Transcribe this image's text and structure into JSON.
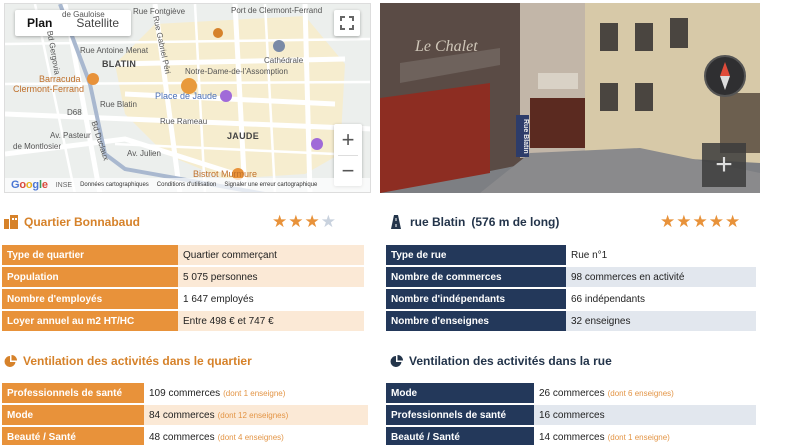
{
  "map": {
    "tab_plan": "Plan",
    "tab_satellite": "Satellite",
    "labels": {
      "port": "Port de Clermont-Ferrand",
      "fontgieve": "Rue Fontgiève",
      "blatin": "BLATIN",
      "jaude": "JAUDE",
      "cathedrale": "Cathédrale",
      "notredame": "Notre-Dame-de-l'Assomption",
      "place_jaude": "Place de Jaude",
      "barracuda": "Barracuda",
      "barracuda2": "Clermont-Ferrand",
      "bistrot": "Bistrot Murmure",
      "rue_blatin": "Rue Blatin",
      "rue_rameau": "Rue Rameau",
      "av_julien": "Av. Julien",
      "av_pasteur": "Av. Pasteur",
      "bd_duclaux": "Bd Duclaux",
      "rue_montlosier": "de Montlosier",
      "rue_menat": "Rue Antoine Menat",
      "rue_gabriel": "Rue Gabriel Péri",
      "bd_gergovia": "Bd Gergovia",
      "insee": "INSE",
      "d68": "D68",
      "gauloise": "de Gauloise"
    },
    "footer": {
      "data": "Données cartographiques",
      "terms": "Conditions d'utilisation",
      "report": "Signaler une erreur cartographique"
    },
    "zoom_in": "+",
    "zoom_out": "−"
  },
  "streetview": {
    "plus": "+",
    "sign": "Rue Blatin",
    "shop": "Le Chalet"
  },
  "quartier": {
    "title": "Quartier Bonnabaud",
    "rating": 3,
    "rating_max": 4,
    "rows": [
      {
        "label": "Type de quartier",
        "value": "Quartier commerçant"
      },
      {
        "label": "Population",
        "value": "5 075 personnes"
      },
      {
        "label": "Nombre d'employés",
        "value": "1 647 employés"
      },
      {
        "label": "Loyer annuel au m2 HT/HC",
        "value": "Entre 498 € et 747 €"
      }
    ]
  },
  "rue": {
    "title": "rue Blatin",
    "length": "(576 m de long)",
    "rating": 5,
    "rating_max": 5,
    "rows": [
      {
        "label": "Type de rue",
        "value": "Rue n°1"
      },
      {
        "label": "Nombre de commerces",
        "value": "98 commerces en activité"
      },
      {
        "label": "Nombre d'indépendants",
        "value": "66 indépendants"
      },
      {
        "label": "Nombre d'enseignes",
        "value": "32 enseignes"
      }
    ]
  },
  "vent_quartier": {
    "title": "Ventilation des activités dans le quartier",
    "rows": [
      {
        "label": "Professionnels de santé",
        "value": "109 commerces",
        "extra": "(dont 1 enseigne)"
      },
      {
        "label": "Mode",
        "value": "84 commerces",
        "extra": "(dont 12 enseignes)"
      },
      {
        "label": "Beauté / Santé",
        "value": "48 commerces",
        "extra": "(dont 4 enseignes)"
      }
    ]
  },
  "vent_rue": {
    "title": "Ventilation des activités dans la rue",
    "rows": [
      {
        "label": "Mode",
        "value": "26 commerces",
        "extra": "(dont 6 enseignes)"
      },
      {
        "label": "Professionnels de santé",
        "value": "16 commerces",
        "extra": ""
      },
      {
        "label": "Beauté / Santé",
        "value": "14 commerces",
        "extra": "(dont 1 enseigne)"
      }
    ]
  },
  "colors": {
    "orange": "#e8923a",
    "navy": "#23385a",
    "star_on": "#e8923a",
    "star_off": "#c9d2de"
  }
}
